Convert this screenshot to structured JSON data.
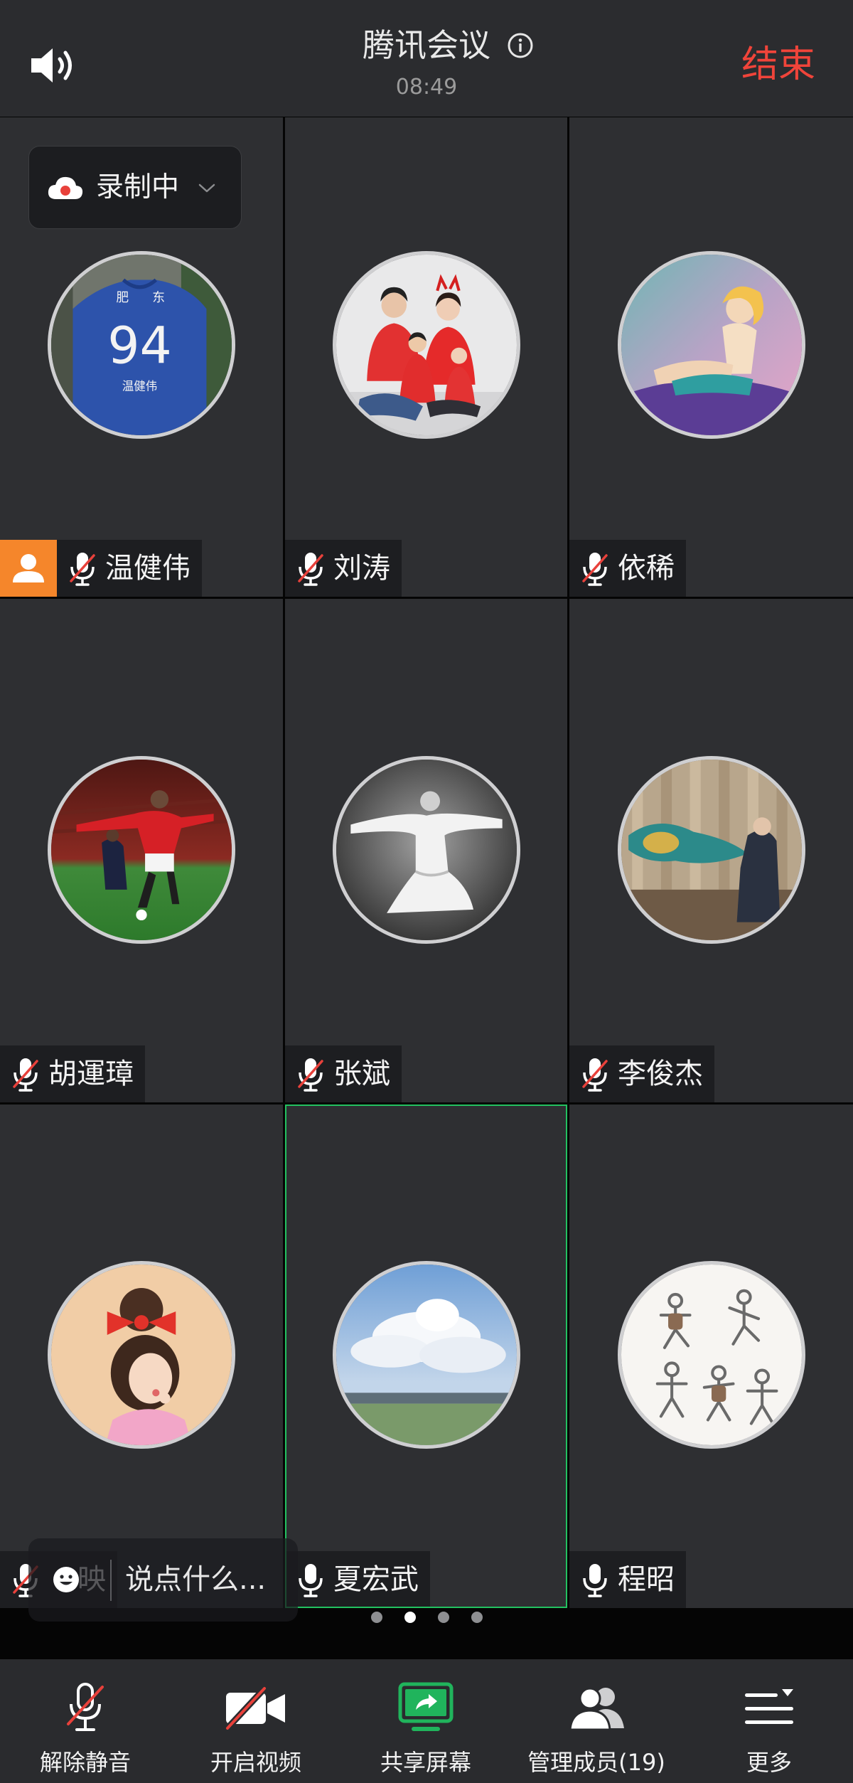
{
  "meeting": {
    "title": "腾讯会议",
    "time": "08:49",
    "end_label": "结束"
  },
  "recording": {
    "label": "录制中",
    "icon": "cloud-record-icon"
  },
  "participants": [
    {
      "name": "温健伟",
      "muted": true,
      "host": true,
      "jersey_text": [
        "肥",
        "东"
      ],
      "jersey_number": "94",
      "jersey_name": "温健伟"
    },
    {
      "name": "刘涛",
      "muted": true
    },
    {
      "name": "依稀",
      "muted": true
    },
    {
      "name": "胡運璋",
      "muted": true
    },
    {
      "name": "张斌",
      "muted": true
    },
    {
      "name": "李俊杰",
      "muted": true
    },
    {
      "name": "映",
      "muted": true
    },
    {
      "name": "夏宏武",
      "muted": false,
      "speaking": true
    },
    {
      "name": "程昭",
      "muted": false
    }
  ],
  "chat": {
    "placeholder": "说点什么...",
    "icon": "emoji-icon"
  },
  "pager": {
    "total": 4,
    "current": 2
  },
  "toolbar": [
    {
      "label": "解除静音",
      "icon": "mic-muted-icon"
    },
    {
      "label": "开启视频",
      "icon": "camera-off-icon"
    },
    {
      "label": "共享屏幕",
      "icon": "share-screen-icon"
    },
    {
      "label": "管理成员(19)",
      "icon": "members-icon"
    },
    {
      "label": "更多",
      "icon": "more-icon"
    }
  ],
  "colors": {
    "end": "#f0443a",
    "muted_slash": "#e8413b",
    "host_badge": "#f5862b",
    "active_speaker": "#22c160",
    "share": "#20b45c"
  }
}
